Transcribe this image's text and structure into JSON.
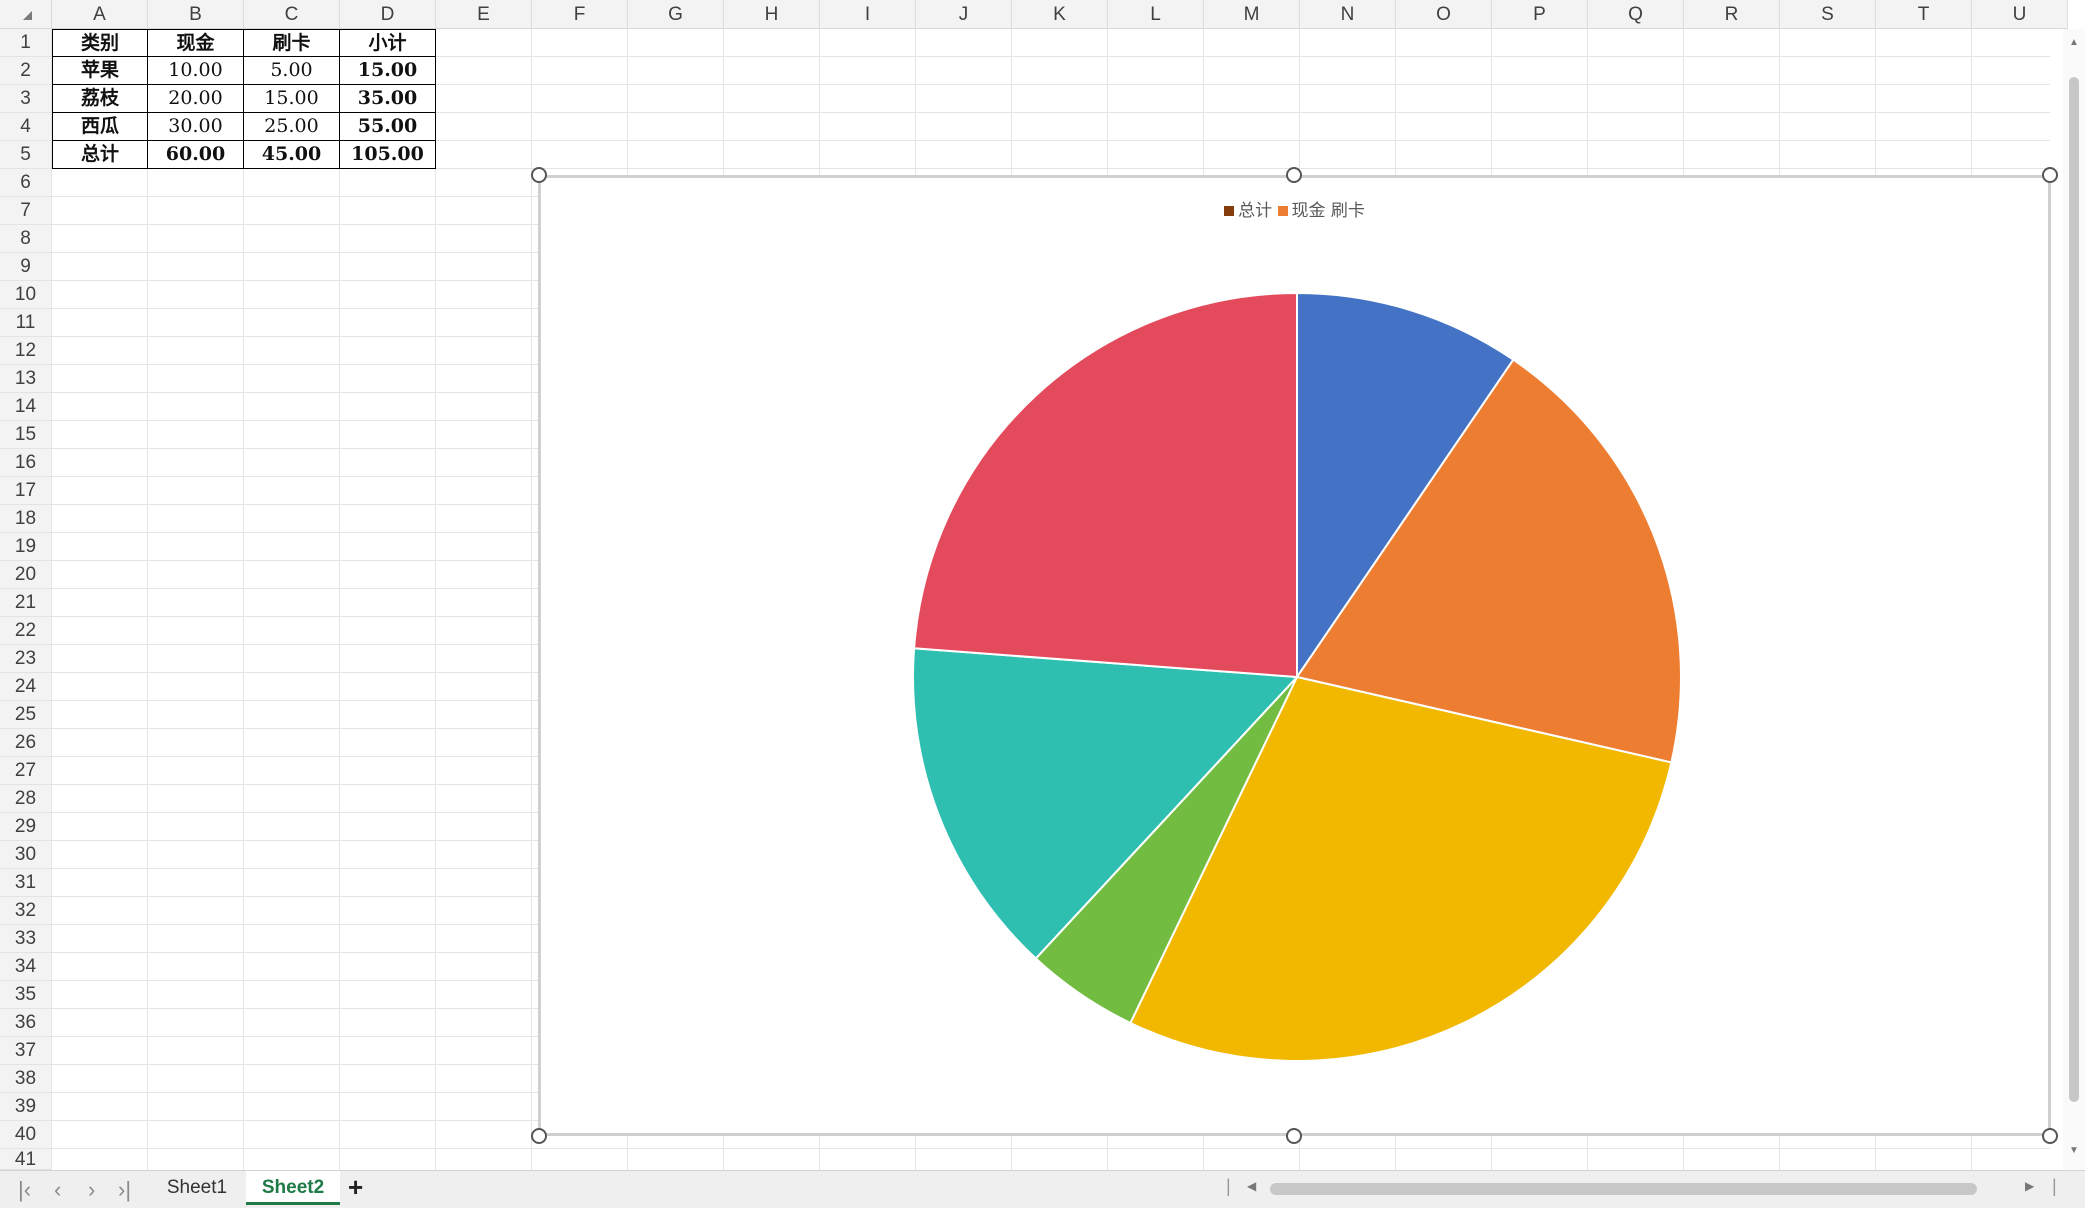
{
  "columns": [
    "A",
    "B",
    "C",
    "D",
    "E",
    "F",
    "G",
    "H",
    "I",
    "J",
    "K",
    "L",
    "M",
    "N",
    "O",
    "P",
    "Q",
    "R",
    "S",
    "T",
    "U"
  ],
  "rows": [
    "1",
    "2",
    "3",
    "4",
    "5",
    "6",
    "7",
    "8",
    "9",
    "10",
    "11",
    "12",
    "13",
    "14",
    "15",
    "16",
    "17",
    "18",
    "19",
    "20",
    "21",
    "22",
    "23",
    "24",
    "25",
    "26",
    "27",
    "28",
    "29",
    "30",
    "31",
    "32",
    "33",
    "34",
    "35",
    "36",
    "37",
    "38",
    "39",
    "40",
    "41"
  ],
  "table": {
    "header": [
      "类别",
      "现金",
      "刷卡",
      "小计"
    ],
    "body": [
      [
        "苹果",
        "10.00",
        "5.00",
        "15.00"
      ],
      [
        "荔枝",
        "20.00",
        "15.00",
        "35.00"
      ],
      [
        "西瓜",
        "30.00",
        "25.00",
        "55.00"
      ],
      [
        "总计",
        "60.00",
        "45.00",
        "105.00"
      ]
    ]
  },
  "chart_data": {
    "type": "pie",
    "legend": [
      {
        "label": "总计",
        "color": "#843c0c"
      },
      {
        "label": "现金",
        "color": "#ed7d31"
      },
      {
        "label": "刷卡",
        "color": "#ed7d31"
      }
    ],
    "legend_position": "top",
    "slices": [
      {
        "value": 10.0,
        "color": "#4472c4"
      },
      {
        "value": 20.0,
        "color": "#ed7d31"
      },
      {
        "value": 30.0,
        "color": "#f2b800"
      },
      {
        "value": 5.0,
        "color": "#72bc41"
      },
      {
        "value": 15.0,
        "color": "#2fbfb1"
      },
      {
        "value": 25.0,
        "color": "#e34b5d"
      }
    ]
  },
  "sheets": {
    "tabs": [
      "Sheet1",
      "Sheet2"
    ],
    "active": "Sheet2",
    "add": "+"
  },
  "icons": {
    "first": "first-sheet-icon",
    "prev": "prev-sheet-icon",
    "next": "next-sheet-icon",
    "last": "last-sheet-icon"
  }
}
